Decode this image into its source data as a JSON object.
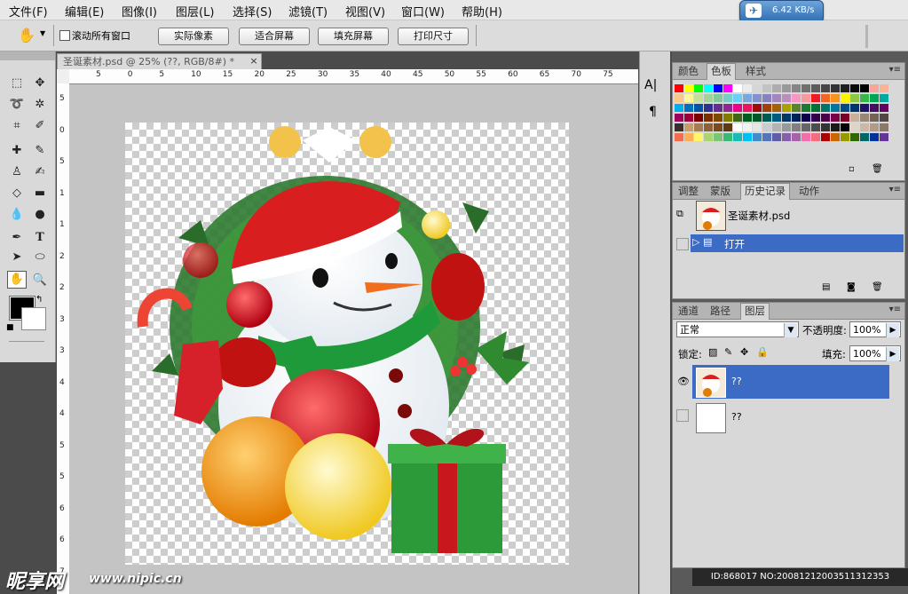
{
  "menu": {
    "items": [
      "文件(F)",
      "编辑(E)",
      "图像(I)",
      "图层(L)",
      "选择(S)",
      "滤镜(T)",
      "视图(V)",
      "窗口(W)",
      "帮助(H)"
    ]
  },
  "net_speed": "6.42 KB/s",
  "options_bar": {
    "scroll_all_label": "滚动所有窗口",
    "buttons": [
      "实际像素",
      "适合屏幕",
      "填充屏幕",
      "打印尺寸"
    ]
  },
  "document": {
    "tab_title": "圣诞素材.psd @ 25% (??, RGB/8#) *",
    "close_glyph": "×",
    "ruler_h": [
      "5",
      "0",
      "5",
      "10",
      "15",
      "20",
      "25",
      "30",
      "35",
      "40",
      "45",
      "50",
      "55",
      "60",
      "65",
      "70",
      "75"
    ],
    "ruler_v": [
      "5",
      "0",
      "5",
      "1",
      "1",
      "2",
      "2",
      "3",
      "3",
      "4",
      "4",
      "5",
      "5",
      "6",
      "6",
      "7"
    ]
  },
  "icons": {
    "hand": "hand-icon",
    "marquee": "marquee-icon",
    "move": "move-icon",
    "lasso": "lasso-icon",
    "magic_wand": "magic-wand-icon",
    "crop": "crop-icon",
    "eyedropper": "eyedropper-icon",
    "healing": "healing-brush-icon",
    "brush": "brush-icon",
    "stamp": "clone-stamp-icon",
    "history_brush": "history-brush-icon",
    "eraser": "eraser-icon",
    "gradient": "gradient-icon",
    "blur": "blur-icon",
    "dodge": "dodge-icon",
    "pen": "pen-icon",
    "type": "type-icon",
    "path_select": "path-selection-icon",
    "shape": "shape-icon",
    "zoom": "zoom-icon"
  },
  "panels": {
    "color_tabs": [
      "颜色",
      "色板",
      "样式"
    ],
    "history_tabs": [
      "调整",
      "蒙版",
      "历史记录",
      "动作"
    ],
    "history_items": [
      "圣诞素材.psd",
      "打开"
    ],
    "layers_tabs": [
      "通道",
      "路径",
      "图层"
    ],
    "blend_mode": "正常",
    "opacity_label": "不透明度:",
    "opacity_value": "100%",
    "lock_label": "锁定:",
    "fill_label": "填充:",
    "fill_value": "100%",
    "layers": [
      "??",
      "??"
    ]
  },
  "side_icons": [
    "A|",
    "¶"
  ],
  "watermark": {
    "logo": "昵享网",
    "url": "www.nipic.cn",
    "id_text": "ID:868017 NO:20081212003511312353"
  },
  "colors": {
    "accent": "#3b6bc4",
    "panel_bg": "#d8d8d8",
    "workspace": "#4b4b4b"
  }
}
